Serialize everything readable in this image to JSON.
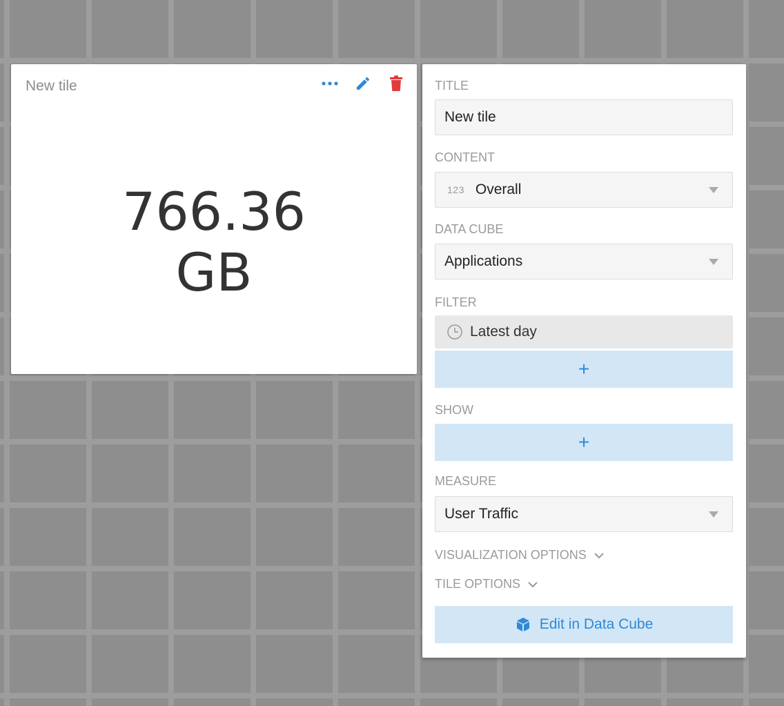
{
  "tile": {
    "title": "New tile",
    "value": "766.36",
    "unit": "GB",
    "actions": [
      {
        "icon": "more-icon",
        "color": "#2f89d8"
      },
      {
        "icon": "pencil-icon",
        "color": "#2f89d8"
      },
      {
        "icon": "trash-icon",
        "color": "#e23b3b"
      }
    ]
  },
  "panel": {
    "title_label": "TITLE",
    "title_value": "New tile",
    "content_label": "CONTENT",
    "content_badge": "123",
    "content_value": "Overall",
    "cube_label": "DATA CUBE",
    "cube_value": "Applications",
    "filter_label": "FILTER",
    "filter_chip": "Latest day",
    "add_symbol": "+",
    "show_label": "SHOW",
    "measure_label": "MEASURE",
    "measure_value": "User Traffic",
    "viz_options": "VISUALIZATION OPTIONS",
    "tile_options": "TILE OPTIONS",
    "edit_button": "Edit in Data Cube"
  },
  "colors": {
    "accent": "#2f89d8",
    "danger": "#e23b3b",
    "button_bg": "#d2e6f6"
  }
}
